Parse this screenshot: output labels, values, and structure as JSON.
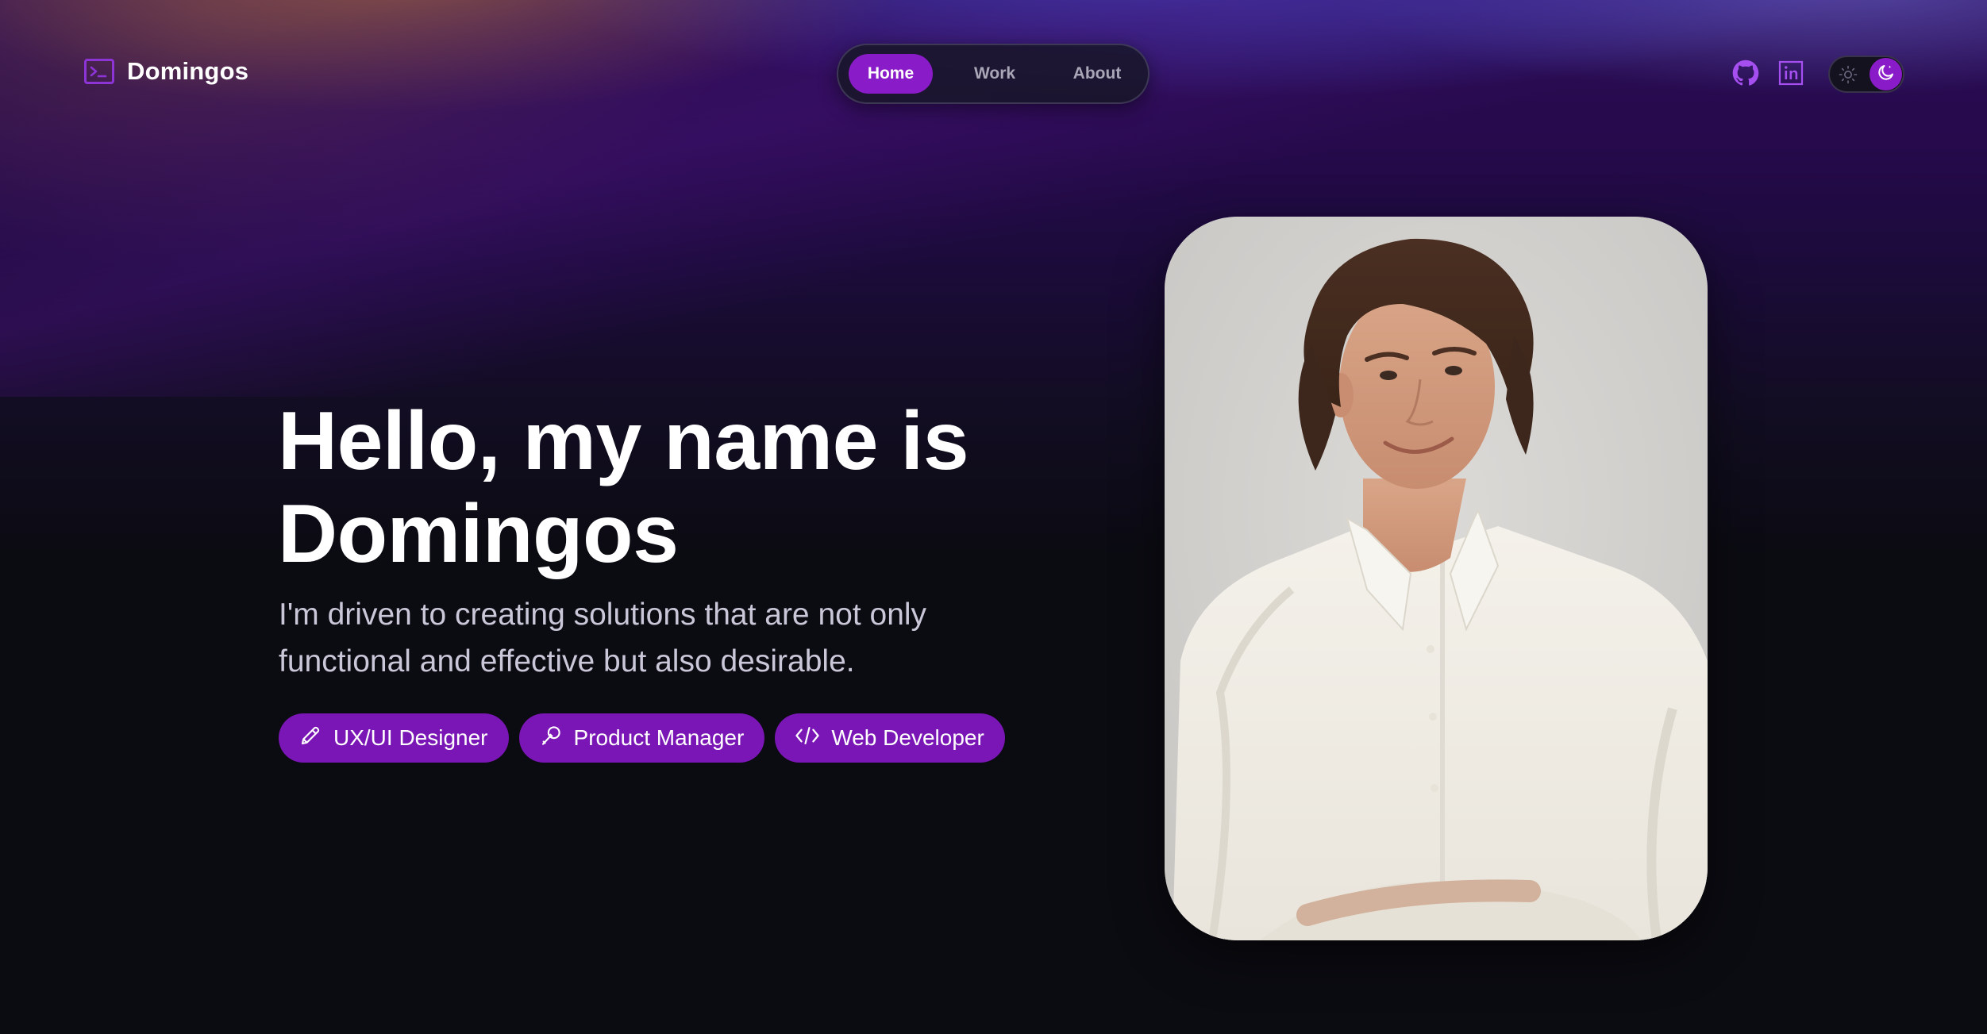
{
  "brand": {
    "name": "Domingos"
  },
  "nav": {
    "items": [
      {
        "label": "Home",
        "active": true
      },
      {
        "label": "Work",
        "active": false
      },
      {
        "label": "About",
        "active": false
      }
    ]
  },
  "social": {
    "github_icon": "github-icon",
    "linkedin_icon": "linkedin-icon"
  },
  "theme_toggle": {
    "mode": "dark",
    "light_icon": "sun-icon",
    "dark_icon": "moon-icon"
  },
  "hero": {
    "title_line1": "Hello, my name is",
    "title_line2": "Domingos",
    "subtitle": "I'm driven to creating solutions that are not only functional and effective but also desirable.",
    "tags": [
      {
        "label": "UX/UI Designer",
        "icon": "pencil-icon"
      },
      {
        "label": "Product Manager",
        "icon": "microphone-icon"
      },
      {
        "label": "Web Developer",
        "icon": "code-icon"
      }
    ]
  },
  "portrait": {
    "subject": "portrait-photo"
  },
  "colors": {
    "accent": "#8a1bc8",
    "tag_bg": "#7a16b5",
    "background": "#0b0b12",
    "subtitle_text": "#c9c7d8"
  }
}
